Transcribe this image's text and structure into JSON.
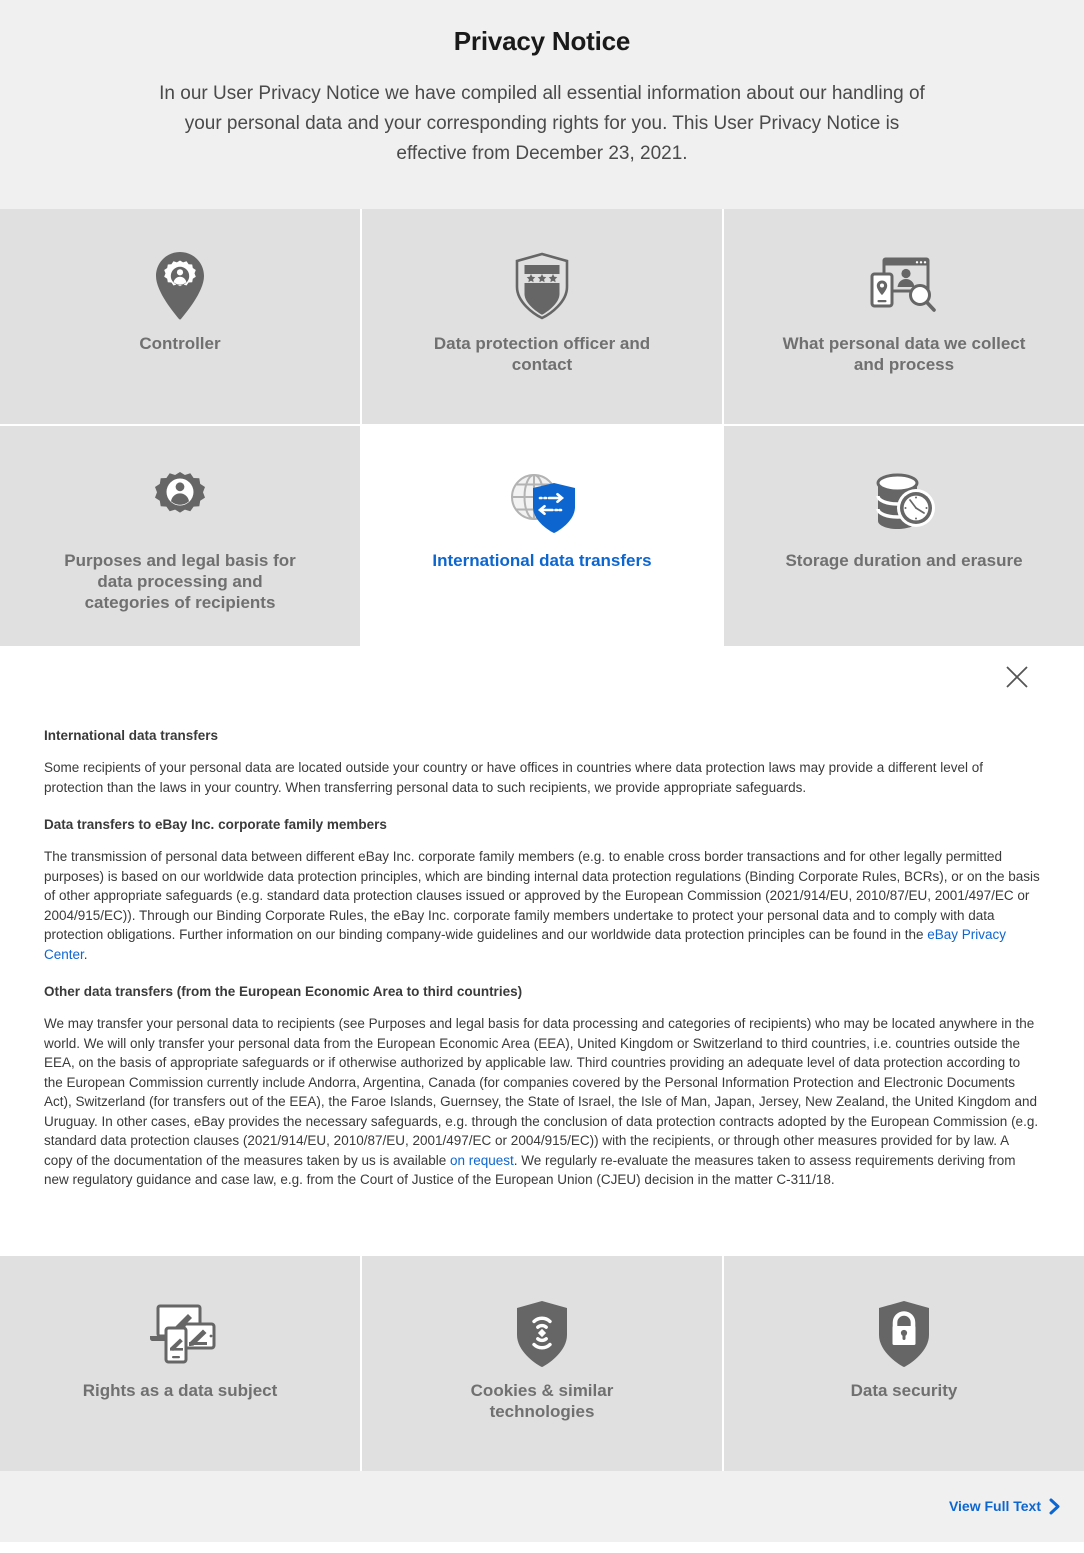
{
  "header": {
    "title": "Privacy Notice",
    "intro": "In our User Privacy Notice we have compiled all essential information about our handling of your personal data and your corresponding rights for you. This User Privacy Notice is effective from December 23, 2021."
  },
  "colors": {
    "accent": "#0d66d0",
    "tile_bg": "#e0e0e0",
    "page_bg": "#f0f0f0",
    "icon_gray": "#666666",
    "label_gray": "#707070"
  },
  "tiles_top": [
    {
      "label": "Controller",
      "icon": "map-pin-gear-person-icon",
      "active": false
    },
    {
      "label": "Data protection officer and contact",
      "icon": "shield-stars-icon",
      "active": false
    },
    {
      "label": "What personal data we collect and process",
      "icon": "devices-person-search-icon",
      "active": false
    }
  ],
  "tiles_middle": [
    {
      "label": "Purposes and legal basis for data processing and categories of recipients",
      "icon": "gear-person-icon",
      "active": false
    },
    {
      "label": "International data transfers",
      "icon": "globe-shield-arrows-icon",
      "active": true
    },
    {
      "label": "Storage duration and erasure",
      "icon": "database-clock-icon",
      "active": false
    }
  ],
  "tiles_bottom": [
    {
      "label": "Rights as a data subject",
      "icon": "multi-device-edit-icon",
      "active": false
    },
    {
      "label": "Cookies & similar technologies",
      "icon": "shield-signal-icon",
      "active": false
    },
    {
      "label": "Data security",
      "icon": "shield-lock-icon",
      "active": false
    }
  ],
  "detail": {
    "close_label": "Close",
    "heading_1": "International data transfers",
    "paragraph_1": "Some recipients of your personal data are located outside your country or have offices in countries where data protection laws may provide a different level of protection than the laws in your country. When transferring personal data to such recipients, we provide appropriate safeguards.",
    "heading_2": "Data transfers to eBay Inc. corporate family members",
    "paragraph_2_a": "The transmission of personal data between different eBay Inc. corporate family members (e.g. to enable cross border transactions and for other legally permitted purposes) is based on our worldwide data protection principles, which are binding internal data protection regulations (Binding Corporate Rules, BCRs), or on the basis of other appropriate safeguards (e.g. standard data protection clauses issued or approved by the European Commission (2021/914/EU, 2010/87/EU, 2001/497/EC or 2004/915/EC)). Through our Binding Corporate Rules, the eBay Inc. corporate family members undertake to protect your personal data and to comply with data protection obligations. Further information on our binding company-wide guidelines and our worldwide data protection principles can be found in the ",
    "paragraph_2_link": "eBay Privacy Center",
    "paragraph_2_b": ".",
    "heading_3": "Other data transfers (from the European Economic Area to third countries)",
    "paragraph_3_a": "We may transfer your personal data to recipients (see Purposes and legal basis for data processing and categories of recipients) who may be located anywhere in the world. We will only transfer your personal data from the European Economic Area (EEA), United Kingdom or Switzerland to third countries, i.e. countries outside the EEA, on the basis of appropriate safeguards or if otherwise authorized by applicable law. Third countries providing an adequate level of data protection according to the European Commission currently include Andorra, Argentina, Canada (for companies covered by the Personal Information Protection and Electronic Documents Act), Switzerland (for transfers out of the EEA), the Faroe Islands, Guernsey, the State of Israel, the Isle of Man, Japan, Jersey, New Zealand, the United Kingdom and Uruguay. In other cases, eBay provides the necessary safeguards, e.g. through the conclusion of data protection contracts adopted by the European Commission (e.g. standard data protection clauses (2021/914/EU, 2010/87/EU, 2001/497/EC or 2004/915/EC)) with the recipients, or through other measures provided for by law. A copy of the documentation of the measures taken by us is available ",
    "paragraph_3_link": "on request",
    "paragraph_3_b": ". We regularly re-evaluate the measures taken to assess requirements deriving from new regulatory guidance and case law, e.g. from the Court of Justice of the European Union (CJEU) decision in the matter C-311/18."
  },
  "footer": {
    "view_full_text": "View Full Text",
    "chevron": "chevron-right-icon"
  }
}
